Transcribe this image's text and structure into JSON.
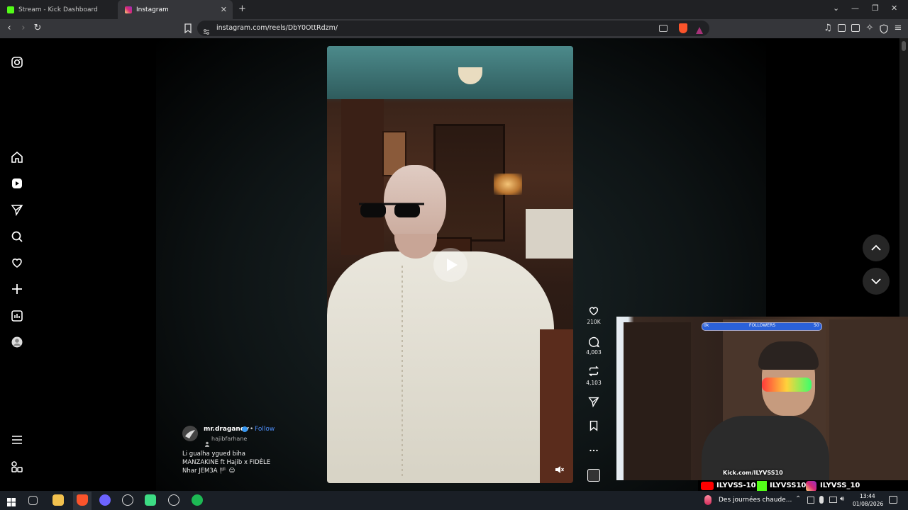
{
  "browser": {
    "tabs": [
      {
        "title": "Stream - Kick Dashboard",
        "icon": "kick-icon",
        "color": "#53fc18"
      },
      {
        "title": "Instagram",
        "icon": "instagram-icon",
        "color": "#e1306c"
      }
    ],
    "new_tab_symbol": "+",
    "url": "instagram.com/reels/DbY0OttRdzm/"
  },
  "sidebar": {
    "items": [
      "instagram-icon",
      "home-icon",
      "reels-icon",
      "direct-icon",
      "search-icon",
      "heart-icon",
      "create-icon",
      "dashboard-icon",
      "profile-icon"
    ],
    "bottom": [
      "menu-icon",
      "more-icon"
    ]
  },
  "reel": {
    "likes": "210K",
    "comments": "4,003",
    "reposts": "4,103",
    "author": "mr.draganov",
    "follow_sep": "•",
    "follow_label": "Follow",
    "audio": "hajibfarhane",
    "caption_lines": [
      "Li gualha ygued biha",
      "MANZAKINE ft Hajib x FIDÈLE",
      "Nhar JEM3A 🏴 😊"
    ]
  },
  "stream_overlay": {
    "followers_label": "FOLLOWERS",
    "followers_min": "0k",
    "followers_max": "50",
    "kick_url": "Kick.com/ILYVSS10",
    "youtube": "ILYVSS-10",
    "kick": "ILYVSS10",
    "instagram": "ILYVSS_10"
  },
  "taskbar": {
    "weather": "Des journées chaude...",
    "time": "13:44",
    "date": "01/08/2026"
  },
  "colors": {
    "accent_blue": "#4c8bf5",
    "verified": "#3797f0"
  }
}
